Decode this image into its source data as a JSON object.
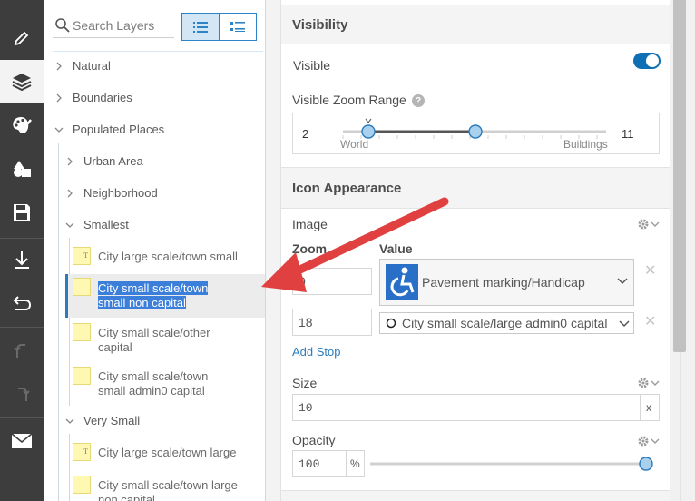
{
  "toolbar": {
    "items": [
      {
        "icon": "pencil-icon"
      },
      {
        "icon": "layers-icon",
        "active": true
      },
      {
        "icon": "palette-icon"
      },
      {
        "icon": "shapes-icon"
      },
      {
        "icon": "save-icon"
      },
      {
        "icon": "download-icon"
      },
      {
        "icon": "undo-icon"
      },
      {
        "icon": "undo-arrow-icon",
        "disabled": true
      },
      {
        "icon": "redo-arrow-icon",
        "disabled": true
      },
      {
        "icon": "mail-icon"
      }
    ]
  },
  "layers": {
    "search_placeholder": "Search Layers",
    "tree": [
      {
        "label": "Natural",
        "expanded": false
      },
      {
        "label": "Boundaries",
        "expanded": false
      },
      {
        "label": "Populated Places",
        "expanded": true
      },
      {
        "label": "Urban Area",
        "expanded": false
      },
      {
        "label": "Neighborhood",
        "expanded": false
      },
      {
        "label": "Smallest",
        "expanded": true
      },
      {
        "label": "Very Small",
        "expanded": true
      }
    ],
    "leaves": [
      {
        "line1": "City large scale/town small",
        "line2": "",
        "symbol": "T"
      },
      {
        "line1": "City small scale/town",
        "line2": "small non capital",
        "symbol": "",
        "selected": true
      },
      {
        "line1": "City small scale/other",
        "line2": "capital",
        "symbol": ""
      },
      {
        "line1": "City small scale/town",
        "line2": "small admin0 capital",
        "symbol": ""
      },
      {
        "line1": "City large scale/town large",
        "line2": "",
        "symbol": "T"
      },
      {
        "line1": "City small scale/town large",
        "line2": "non capital",
        "symbol": ""
      }
    ]
  },
  "visibility": {
    "heading": "Visibility",
    "visible_label": "Visible",
    "visible_on": true,
    "zoom_range_label": "Visible Zoom Range",
    "zoom_min": "2",
    "zoom_max": "11",
    "cap_world": "World",
    "cap_buildings": "Buildings"
  },
  "icon_appearance": {
    "heading": "Icon Appearance",
    "image_label": "Image",
    "col_zoom": "Zoom",
    "col_value": "Value",
    "stops": [
      {
        "zoom": "0",
        "value": "Pavement marking/Handicap"
      },
      {
        "zoom": "18",
        "value": "City small scale/large admin0 capital"
      }
    ],
    "add_stop": "Add Stop",
    "size_label": "Size",
    "size_value": "10",
    "size_unit": "x",
    "opacity_label": "Opacity",
    "opacity_value": "100",
    "opacity_unit": "%"
  },
  "colors": {
    "accent": "#2b7bbd",
    "toggle": "#0f6fb5",
    "toolbar": "#3d3d3d",
    "arrow": "#e0403f"
  }
}
